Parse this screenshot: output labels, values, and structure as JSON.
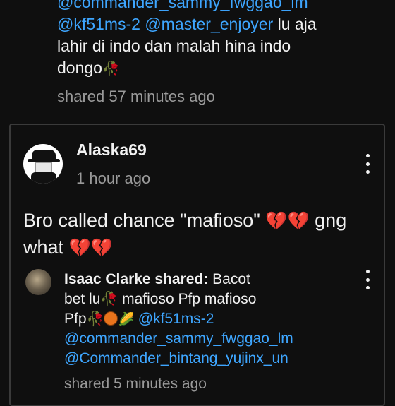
{
  "top_comment": {
    "mention_line1": "@commander_sammy_fwggao_lm",
    "mention_a": "@kf51ms-2",
    "mention_b": "@master_enjoyer",
    "text_a": " lu aja",
    "text_b": "lahir di indo dan malah hina indo",
    "text_c": "dongo",
    "rose_icon": "wilted-rose",
    "meta": "shared 57 minutes ago"
  },
  "post": {
    "username": "Alaska69",
    "time": "1 hour ago",
    "text_a": "Bro called chance \"mafioso\"",
    "text_b": "gng",
    "text_c": "what",
    "heart_icon": "broken-heart",
    "heart_color": "#ff1f4b"
  },
  "reply": {
    "author": "Isaac Clarke shared:",
    "text_a": " Bacot",
    "text_b": "bet lu",
    "text_c": " mafioso Pfp mafioso",
    "text_d": "Pfp",
    "mention_a": "@kf51ms-2",
    "mention_b": "@commander_sammy_fwggao_lm",
    "mention_c": "@Commander_bintang_yujinx_un",
    "meta": "shared 5 minutes ago"
  },
  "colors": {
    "background": "#0f0f0f",
    "mention": "#3ea6ff",
    "meta": "#9a9a9a"
  }
}
